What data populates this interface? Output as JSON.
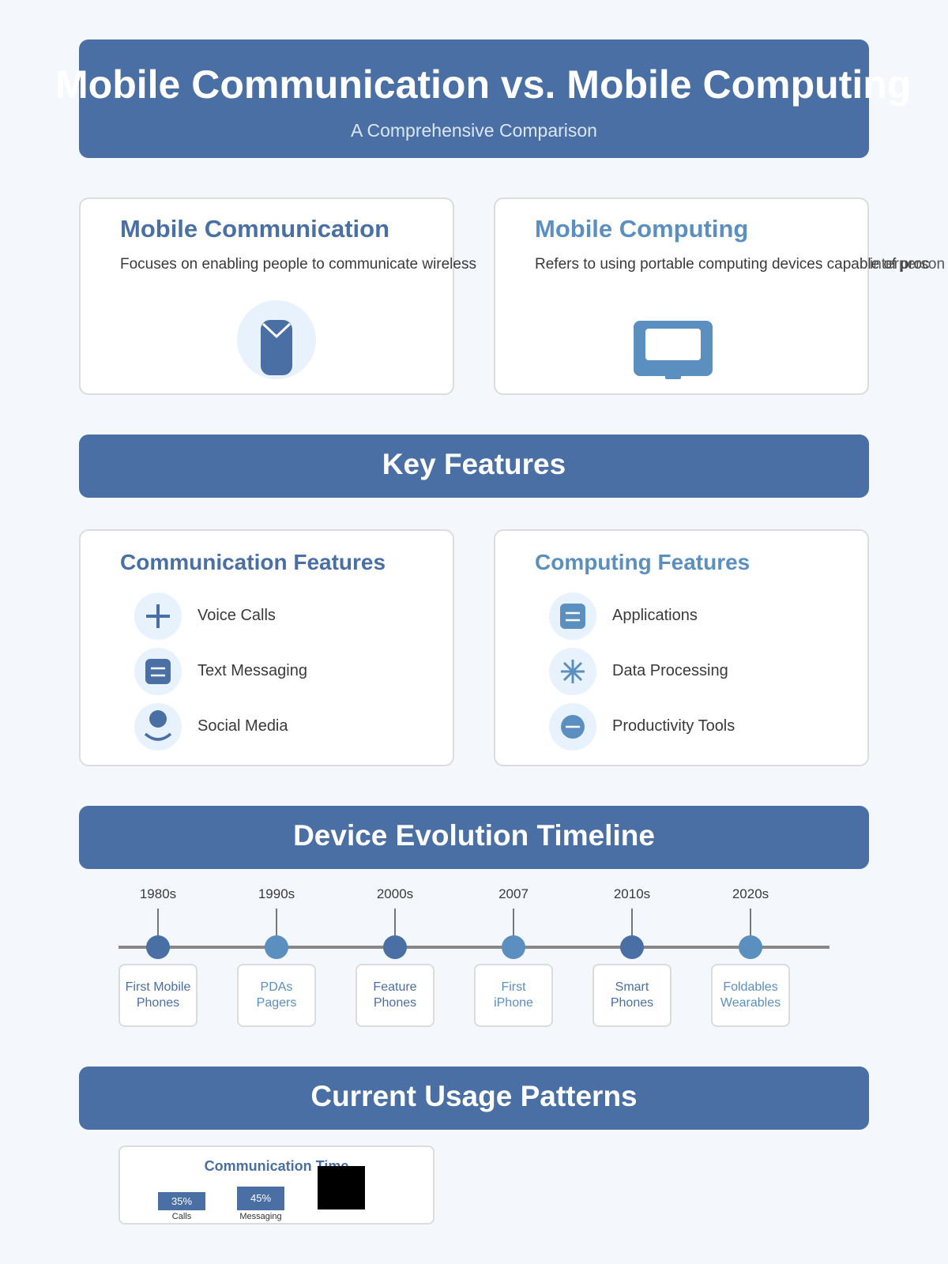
{
  "header": {
    "title": "Mobile Communication vs. Mobile Computing",
    "subtitle": "A Comprehensive Comparison"
  },
  "overview": {
    "communication": {
      "heading": "Mobile Communication",
      "description": "Focuses on enabling people to communicate wireless",
      "icon": "phone-icon"
    },
    "computing": {
      "heading": "Mobile Computing",
      "description": "Refers to using portable computing devices capable of proc",
      "overflow_text": "interperson",
      "icon": "monitor-icon"
    }
  },
  "sections": {
    "key_features": "Key Features",
    "timeline": "Device Evolution Timeline",
    "usage": "Current Usage Patterns"
  },
  "features": {
    "communication": {
      "heading": "Communication Features",
      "items": [
        {
          "label": "Voice Calls",
          "icon": "plus-icon"
        },
        {
          "label": "Text Messaging",
          "icon": "message-icon"
        },
        {
          "label": "Social Media",
          "icon": "person-icon"
        }
      ]
    },
    "computing": {
      "heading": "Computing Features",
      "items": [
        {
          "label": "Applications",
          "icon": "app-icon"
        },
        {
          "label": "Data Processing",
          "icon": "asterisk-icon"
        },
        {
          "label": "Productivity Tools",
          "icon": "minus-circle-icon"
        }
      ]
    }
  },
  "timeline": [
    {
      "year": "1980s",
      "line1": "First Mobile",
      "line2": "Phones",
      "type": "communication"
    },
    {
      "year": "1990s",
      "line1": "PDAs",
      "line2": "Pagers",
      "type": "computing"
    },
    {
      "year": "2000s",
      "line1": "Feature",
      "line2": "Phones",
      "type": "communication"
    },
    {
      "year": "2007",
      "line1": "First",
      "line2": "iPhone",
      "type": "computing"
    },
    {
      "year": "2010s",
      "line1": "Smart",
      "line2": "Phones",
      "type": "communication"
    },
    {
      "year": "2020s",
      "line1": "Foldables",
      "line2": "Wearables",
      "type": "computing"
    }
  ],
  "usage": {
    "title": "Communication Time",
    "bars": [
      {
        "label": "Calls",
        "value": 35,
        "display": "35%"
      },
      {
        "label": "Messaging",
        "value": 45,
        "display": "45%"
      }
    ]
  },
  "colors": {
    "primary": "#4a6fa5",
    "secondary": "#5a8fc0",
    "icon_bg": "#e8f2fd",
    "background": "#f4f7fb"
  }
}
